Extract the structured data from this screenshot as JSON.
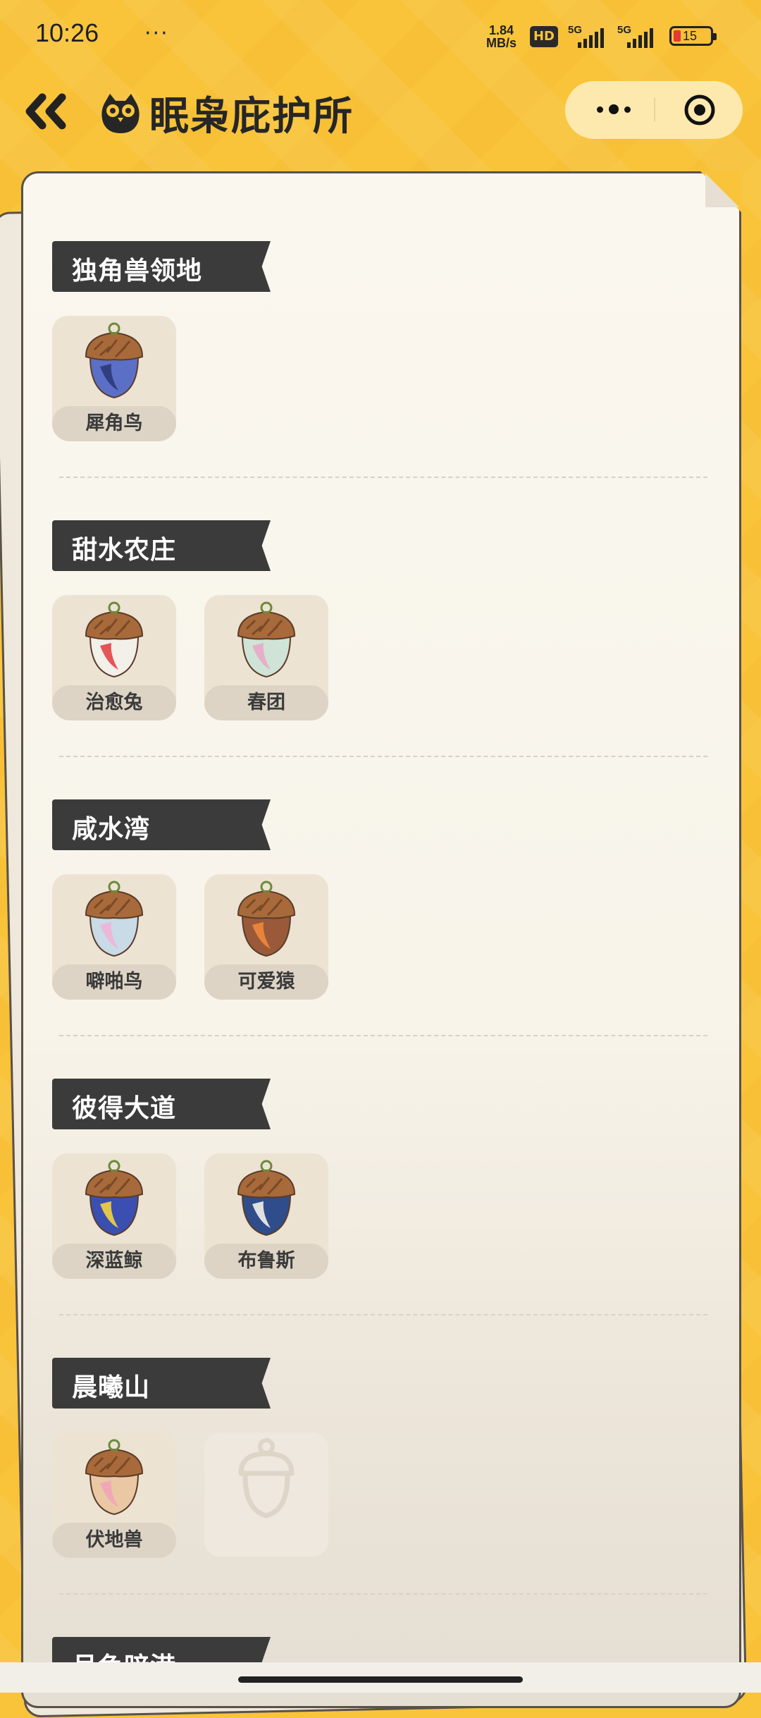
{
  "status_bar": {
    "time": "10:26",
    "dots": "···",
    "speed_value": "1.84",
    "speed_unit": "MB/s",
    "hd_label": "HD",
    "sim1_label": "5G",
    "sim2_label": "5G",
    "battery_level": "15"
  },
  "header": {
    "title": "眠枭庇护所"
  },
  "sections": [
    {
      "title": "独角兽领地",
      "items": [
        {
          "name": "犀角鸟",
          "color": "#5b6fc7",
          "accent": "#2c3a7a"
        }
      ]
    },
    {
      "title": "甜水农庄",
      "items": [
        {
          "name": "治愈兔",
          "color": "#f3efe9",
          "accent": "#e04545"
        },
        {
          "name": "春团",
          "color": "#cfe4d6",
          "accent": "#e8a8c8"
        }
      ]
    },
    {
      "title": "咸水湾",
      "items": [
        {
          "name": "噼啪鸟",
          "color": "#c8dbe6",
          "accent": "#f0b4d8"
        },
        {
          "name": "可爱猿",
          "color": "#9a5a3a",
          "accent": "#f0883a"
        }
      ]
    },
    {
      "title": "彼得大道",
      "items": [
        {
          "name": "深蓝鲸",
          "color": "#3a4fb0",
          "accent": "#f5d33f"
        },
        {
          "name": "布鲁斯",
          "color": "#2f4d8a",
          "accent": "#f4f1ea"
        }
      ]
    },
    {
      "title": "晨曦山",
      "items": [
        {
          "name": "伏地兽",
          "color": "#e9c8a3",
          "accent": "#f2a4b8"
        },
        {
          "name": "",
          "empty": true
        }
      ]
    },
    {
      "title": "月色暗港",
      "items": []
    }
  ]
}
